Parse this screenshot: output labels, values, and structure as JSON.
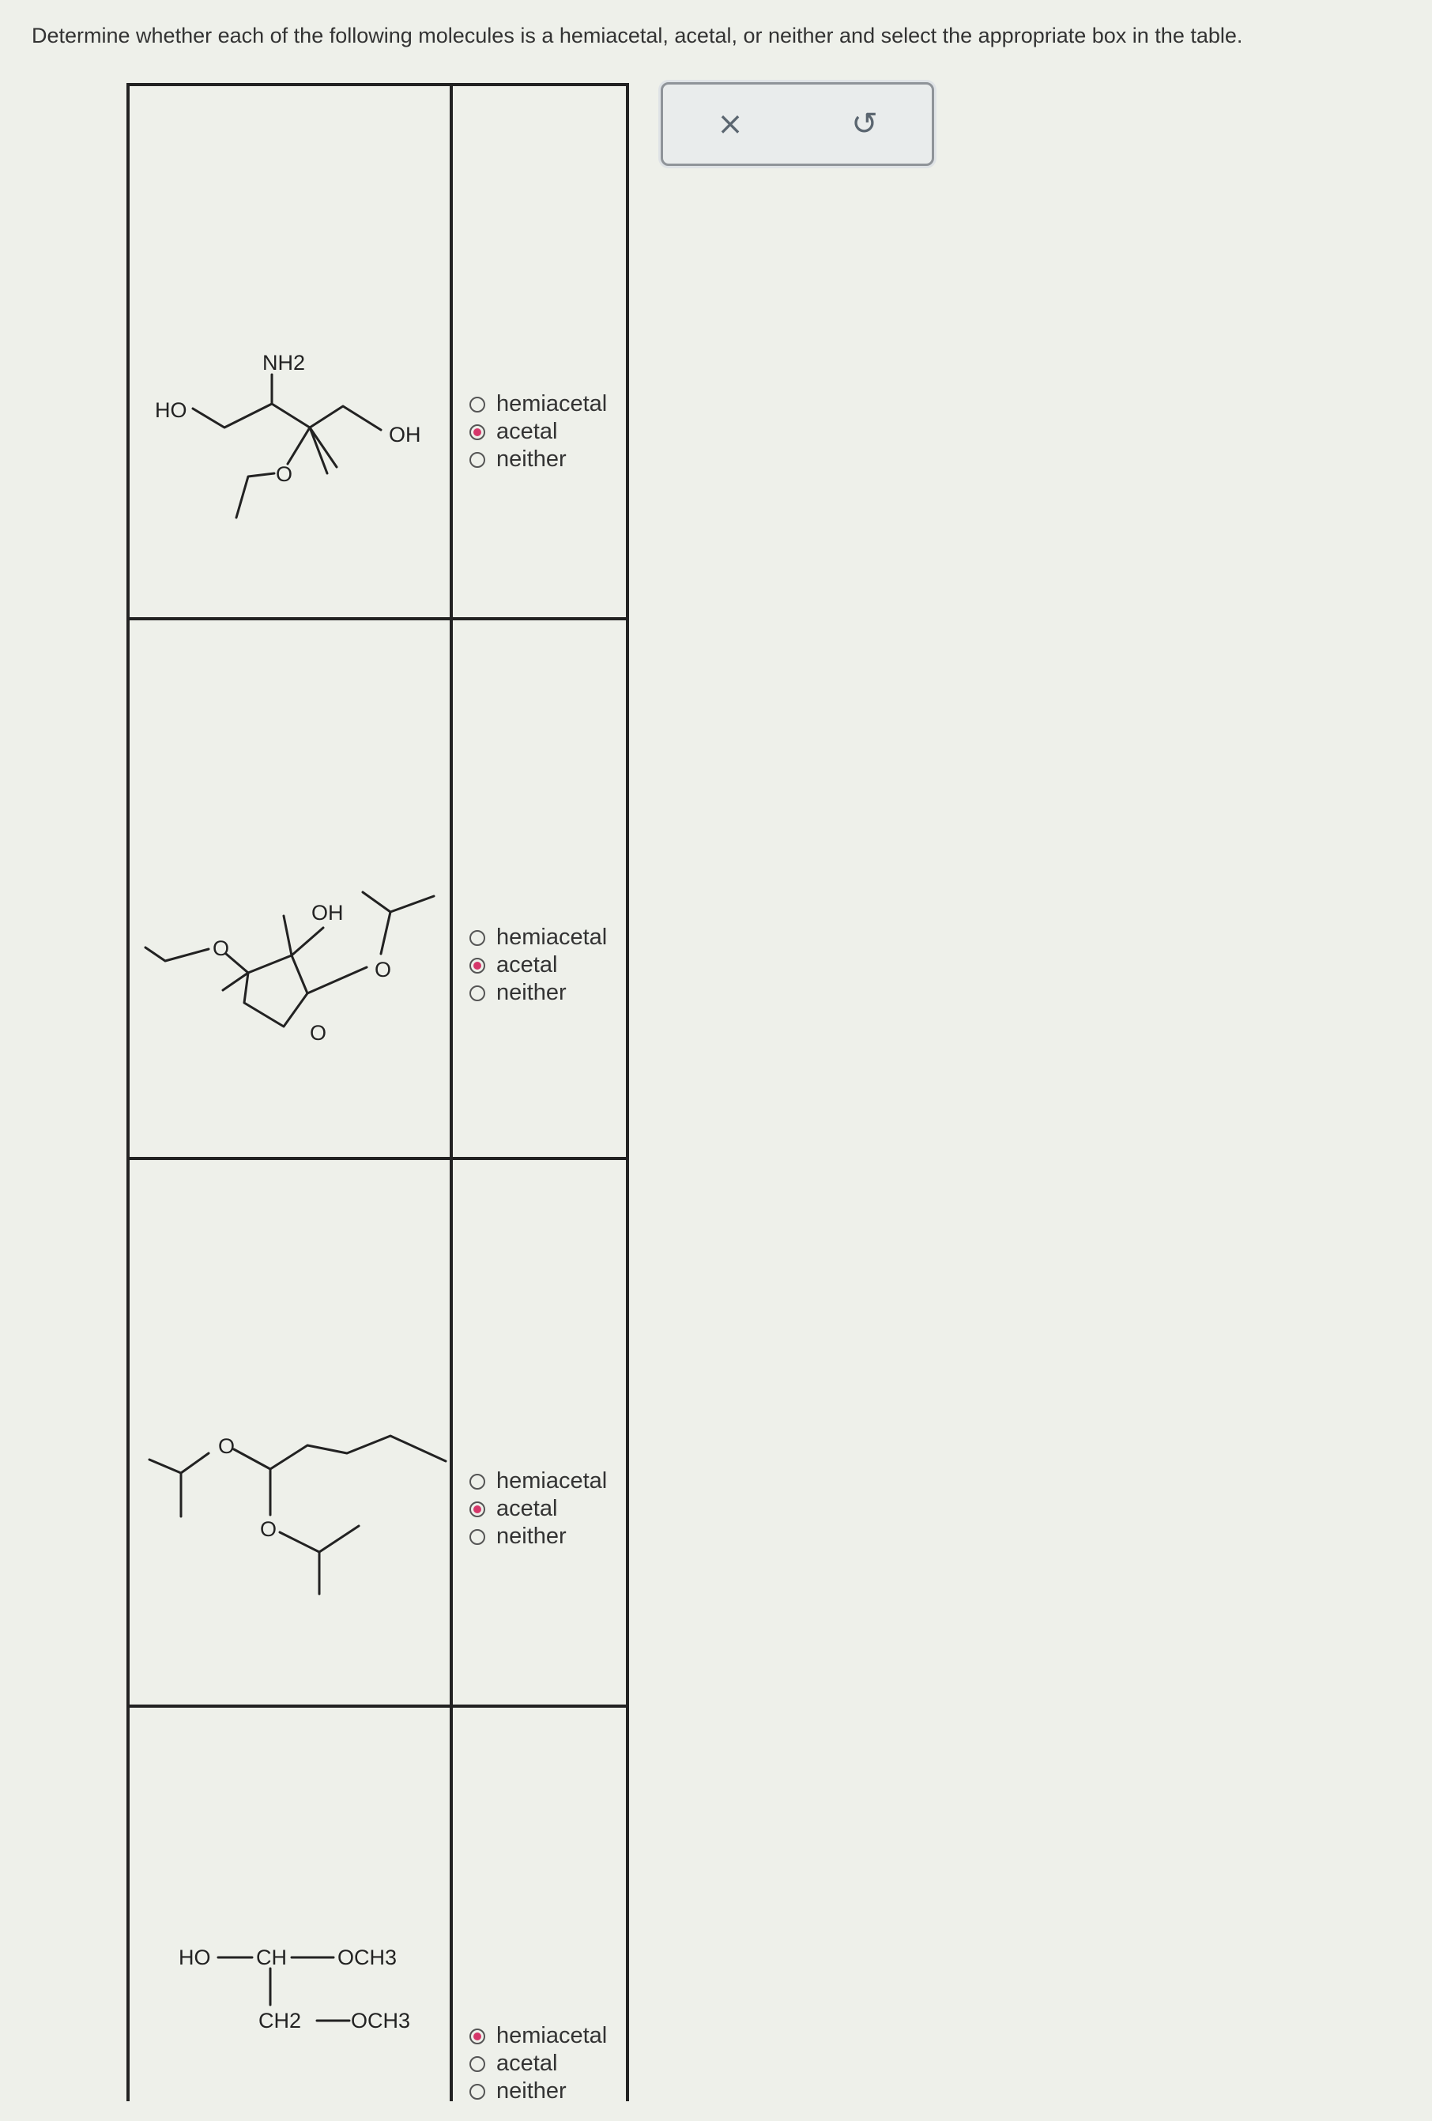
{
  "prompt": "Determine whether each of the following molecules is a hemiacetal, acetal, or neither and select the appropriate box in the table.",
  "toolbar": {
    "clear_icon": "close-icon",
    "clear_label": "×",
    "undo_icon": "undo-icon",
    "undo_label": "↺"
  },
  "rows": [
    {
      "labels": [
        "NH2",
        "HO",
        "OH",
        "O"
      ],
      "options": [
        "hemiacetal",
        "acetal",
        "neither"
      ],
      "selected": "acetal"
    },
    {
      "labels": [
        "OH",
        "O",
        "O",
        "O"
      ],
      "options": [
        "hemiacetal",
        "acetal",
        "neither"
      ],
      "selected": "acetal"
    },
    {
      "labels": [
        "O",
        "O"
      ],
      "options": [
        "hemiacetal",
        "acetal",
        "neither"
      ],
      "selected": "acetal"
    },
    {
      "labels": [
        "HO",
        "CH",
        "OCH3",
        "CH2",
        "OCH3"
      ],
      "options": [
        "hemiacetal",
        "acetal",
        "neither"
      ],
      "selected": "hemiacetal"
    }
  ]
}
